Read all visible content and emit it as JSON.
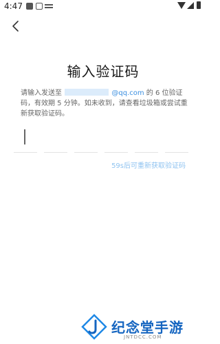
{
  "status_bar": {
    "time": "4:47",
    "icons": [
      "notification-square-icon",
      "text-a-icon",
      "keyboard-line-icon",
      "wifi-icon",
      "signal-icon",
      "battery-icon"
    ]
  },
  "header": {
    "back_icon": "chevron-left-icon"
  },
  "main": {
    "title": "输入验证码",
    "description_prefix": "请输入发送至",
    "email_domain": "@qq.com",
    "description_suffix": "的 6 位验证码，有效期 5 分钟。如未收到，请查看垃圾箱或尝试重新获取验证码。",
    "code_length": 6,
    "code_values": [
      "",
      "",
      "",
      "",
      "",
      ""
    ],
    "resend_label": "59s后可重新获取验证码"
  },
  "watermark": {
    "logo_icon": "j-logo-icon",
    "text": "纪念堂手游",
    "subtext": "JNTDCC.COM"
  },
  "colors": {
    "accent": "#3b8fe0",
    "resend_disabled": "#8fc3f0",
    "watermark": "#1565c0"
  }
}
